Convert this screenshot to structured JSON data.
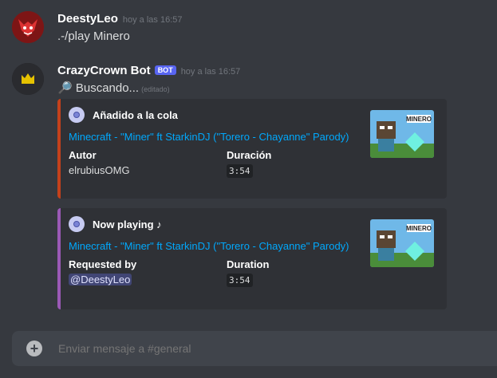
{
  "messages": [
    {
      "username": "DeestyLeo",
      "timestamp": "hoy a las 16:57",
      "content": ".-/play Minero"
    },
    {
      "username": "CrazyCrown Bot",
      "bot_tag": "BOT",
      "timestamp": "hoy a las 16:57",
      "content": "🔎 Buscando...",
      "edited": "(editado)"
    }
  ],
  "embeds": [
    {
      "bar_color": "#c4411b",
      "author": "Añadido a la cola",
      "title": "Minecraft - \"Miner\" ft StarkinDJ (\"Torero - Chayanne\" Parody)",
      "fields": [
        {
          "name": "Autor",
          "value": "elrubiusOMG"
        },
        {
          "name": "Duración",
          "value": "3:54"
        }
      ],
      "thumbnail_text": "MINERO"
    },
    {
      "bar_color": "#9b59b6",
      "author": "Now playing ♪",
      "title": "Minecraft - \"Miner\" ft StarkinDJ (\"Torero - Chayanne\" Parody)",
      "fields": [
        {
          "name": "Requested by",
          "value": "@DeestyLeo"
        },
        {
          "name": "Duration",
          "value": "3:54"
        }
      ],
      "thumbnail_text": "MINERO"
    }
  ],
  "input": {
    "placeholder": "Enviar mensaje a #general"
  },
  "colors": {
    "background": "#36393f",
    "embed_bg": "#2f3136",
    "link": "#00a8fc",
    "bot_tag": "#5865f2"
  }
}
